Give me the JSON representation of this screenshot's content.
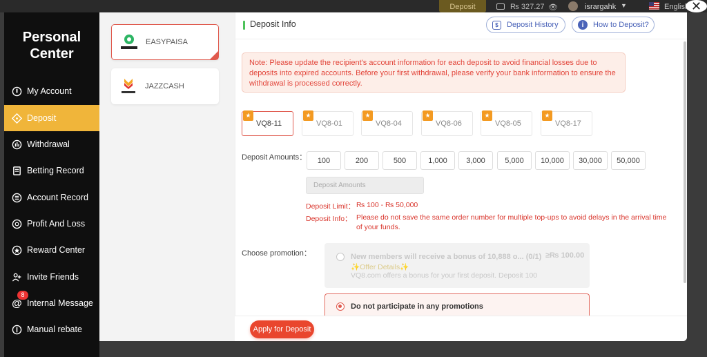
{
  "topbar": {
    "deposit_label": "Deposit",
    "balance": "₨ 327.27",
    "username": "isrargahk",
    "language": "English"
  },
  "sidebar": {
    "title_line1": "Personal",
    "title_line2": "Center",
    "items": [
      {
        "label": "My Account",
        "icon": "account-icon"
      },
      {
        "label": "Deposit",
        "icon": "deposit-icon",
        "active": true
      },
      {
        "label": "Withdrawal",
        "icon": "withdrawal-icon"
      },
      {
        "label": "Betting Record",
        "icon": "betting-record-icon"
      },
      {
        "label": "Account Record",
        "icon": "account-record-icon"
      },
      {
        "label": "Profit And Loss",
        "icon": "profit-loss-icon"
      },
      {
        "label": "Reward Center",
        "icon": "reward-icon"
      },
      {
        "label": "Invite Friends",
        "icon": "invite-icon"
      },
      {
        "label": "Internal Message",
        "icon": "message-icon"
      },
      {
        "label": "Manual rebate",
        "icon": "rebate-icon"
      }
    ],
    "message_badge": "8"
  },
  "payment_methods": [
    {
      "name": "EASYPAISA",
      "logo_text": "easypaisa",
      "selected": true
    },
    {
      "name": "JAZZCASH",
      "logo_text": "JazzCash",
      "selected": false
    }
  ],
  "header": {
    "title": "Deposit Info",
    "history_button": "Deposit History",
    "howto_button": "How to Deposit?"
  },
  "note": "Note: Please update the recipient's account information for each deposit to avoid financial losses due to deposits into expired accounts. Before your first withdrawal, please verify your bank information to ensure the withdrawal is processed correctly.",
  "channels": [
    "VQ8-11",
    "VQ8-01",
    "VQ8-04",
    "VQ8-06",
    "VQ8-05",
    "VQ8-17"
  ],
  "amounts": {
    "label": "Deposit Amounts：",
    "options": [
      "100",
      "200",
      "500",
      "1,000",
      "3,000",
      "5,000",
      "10,000",
      "30,000",
      "50,000"
    ],
    "input_placeholder": "Deposit Amounts"
  },
  "deposit_limit": {
    "label": "Deposit Limit：",
    "value": "₨ 100 - ₨ 50,000"
  },
  "deposit_info": {
    "label": "Deposit Info：",
    "text": "Please do not save the same order number for multiple top-ups to avoid delays in the arrival time of your funds."
  },
  "promotion": {
    "label": "Choose promotion：",
    "option1_title": "New members will receive a bonus of 10,888 o... (0/1)",
    "option1_min": "≥₨ 100.00",
    "option1_details": "✨Offer Details✨",
    "option1_desc": "VQ8.com offers a bonus for your first deposit. Deposit 100",
    "option2_title": "Do not participate in any promotions"
  },
  "apply_button": "Apply for Deposit",
  "colors": {
    "accent": "#f0b53a",
    "primary_red": "#e9462e",
    "link_blue": "#4a63b8",
    "green": "#4cc25a"
  }
}
